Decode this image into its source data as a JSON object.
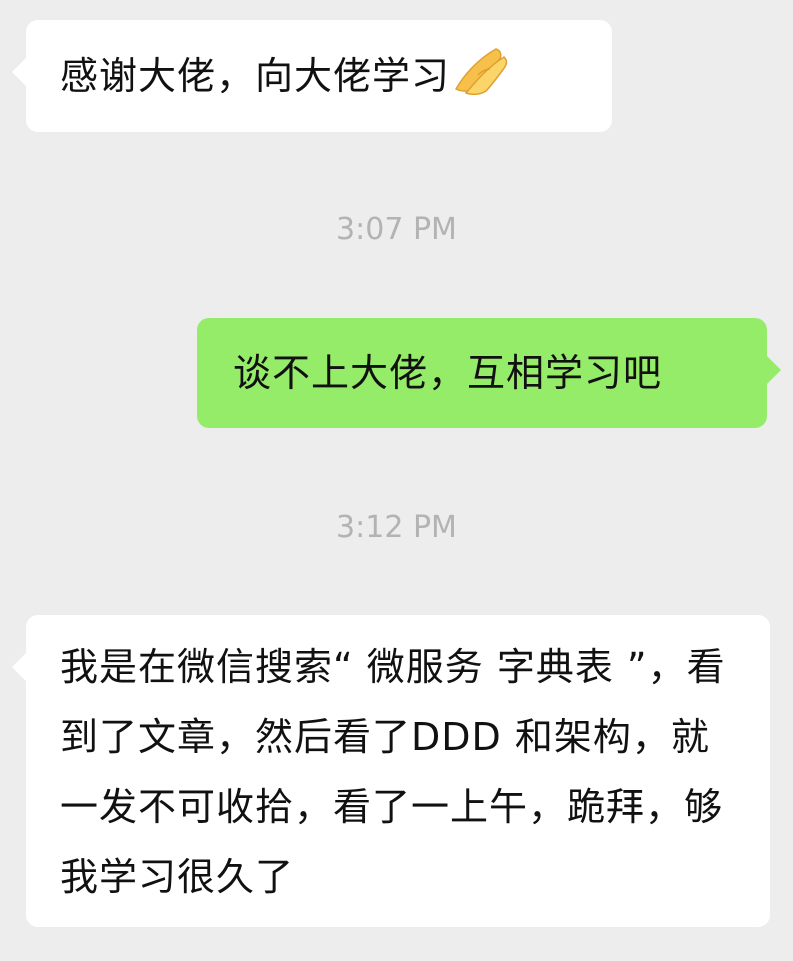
{
  "chat": {
    "messages": [
      {
        "side": "left",
        "text": "感谢大佬，向大佬学习",
        "emoji": "folded-hands-icon"
      },
      {
        "side": "right",
        "text": "谈不上大佬，互相学习吧"
      },
      {
        "side": "left",
        "text": "我是在微信搜索“ 微服务 字典表 ”，看到了文章，然后看了DDD 和架构，就一发不可收拾，看了一上午，跪拜，够我学习很久了"
      }
    ],
    "timestamps": [
      "3:07 PM",
      "3:12 PM"
    ]
  },
  "colors": {
    "background": "#ededed",
    "incoming_bubble": "#ffffff",
    "outgoing_bubble": "#95ec69",
    "timestamp_text": "#b3b3b3"
  }
}
